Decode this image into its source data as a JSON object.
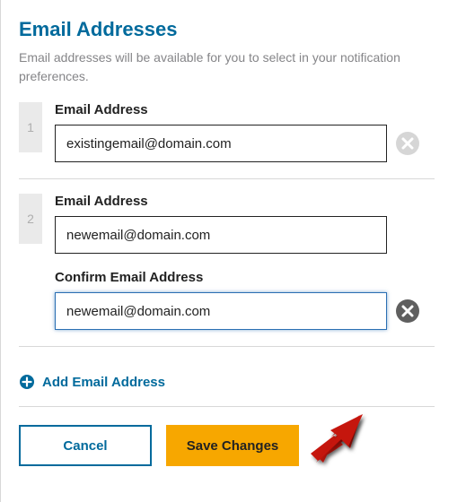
{
  "header": {
    "title": "Email Addresses",
    "description": "Email addresses will be available for you to select in your notification preferences."
  },
  "entries": [
    {
      "index": "1",
      "label": "Email Address",
      "value": "existingemail@domain.com"
    },
    {
      "index": "2",
      "label": "Email Address",
      "value": "newemail@domain.com",
      "confirm_label": "Confirm Email Address",
      "confirm_value": "newemail@domain.com"
    }
  ],
  "add_link": {
    "label": "Add Email Address"
  },
  "buttons": {
    "cancel": "Cancel",
    "save": "Save Changes"
  },
  "colors": {
    "brand_blue": "#006a9c",
    "accent_orange": "#f7a700",
    "arrow_red": "#c5130c"
  }
}
